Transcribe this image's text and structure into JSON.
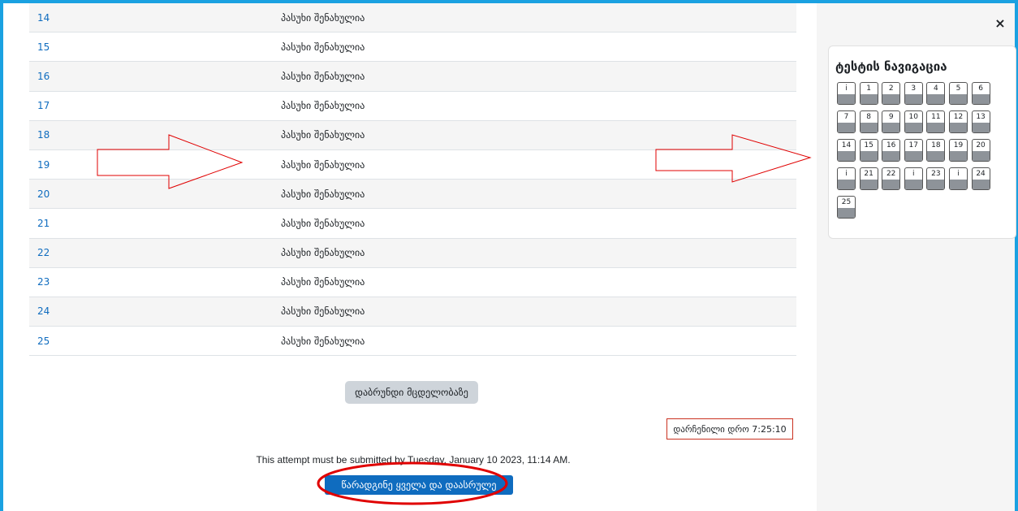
{
  "summary": {
    "rows": [
      {
        "num": "14",
        "status": "პასუხი შენახულია"
      },
      {
        "num": "15",
        "status": "პასუხი შენახულია"
      },
      {
        "num": "16",
        "status": "პასუხი შენახულია"
      },
      {
        "num": "17",
        "status": "პასუხი შენახულია"
      },
      {
        "num": "18",
        "status": "პასუხი შენახულია"
      },
      {
        "num": "19",
        "status": "პასუხი შენახულია"
      },
      {
        "num": "20",
        "status": "პასუხი შენახულია"
      },
      {
        "num": "21",
        "status": "პასუხი შენახულია"
      },
      {
        "num": "22",
        "status": "პასუხი შენახულია"
      },
      {
        "num": "23",
        "status": "პასუხი შენახულია"
      },
      {
        "num": "24",
        "status": "პასუხი შენახულია"
      },
      {
        "num": "25",
        "status": "პასუხი შენახულია"
      }
    ]
  },
  "actions": {
    "return_label": "დაბრუნდი მცდელობაზე",
    "timer_label": "დარჩენილი დრო 7:25:10",
    "deadline_text": "This attempt must be submitted by Tuesday, January 10 2023, 11:14 AM.",
    "submit_label": "წარადგინე ყველა და დაასრულე"
  },
  "drawer": {
    "close_icon": "×",
    "title": "ტესტის ნავიგაცია",
    "questions": [
      "i",
      "1",
      "2",
      "3",
      "4",
      "5",
      "6",
      "7",
      "8",
      "9",
      "10",
      "11",
      "12",
      "13",
      "14",
      "15",
      "16",
      "17",
      "18",
      "19",
      "20",
      "i",
      "21",
      "22",
      "i",
      "23",
      "i",
      "24",
      "25"
    ]
  },
  "colors": {
    "frame": "#1aa1e1",
    "link": "#0f6cbf",
    "primary": "#0f6cbf",
    "annotation": "#e00000"
  }
}
